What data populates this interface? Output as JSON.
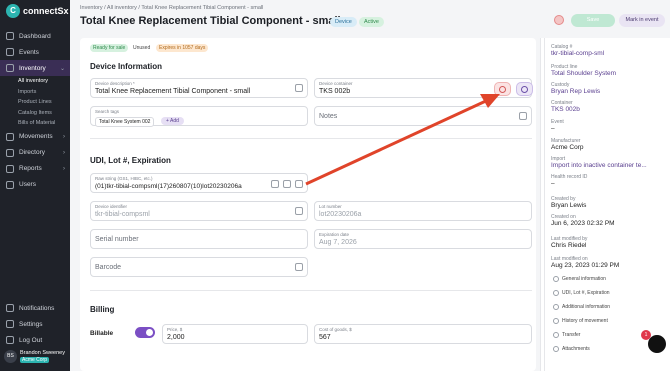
{
  "brand": {
    "name": "connectSx",
    "logo_letter": "C"
  },
  "nav": {
    "items": [
      {
        "label": "Dashboard"
      },
      {
        "label": "Events"
      },
      {
        "label": "Inventory"
      }
    ],
    "inventory_sub": [
      "All inventory",
      "Imports",
      "Product Lines",
      "Catalog Items",
      "Bills of Material"
    ],
    "items_after": [
      {
        "label": "Movements"
      },
      {
        "label": "Directory"
      },
      {
        "label": "Reports"
      },
      {
        "label": "Users"
      }
    ],
    "bottom": [
      {
        "label": "Notifications"
      },
      {
        "label": "Settings"
      },
      {
        "label": "Log Out"
      }
    ]
  },
  "user": {
    "initials": "BS",
    "name": "Brandon Sweeney",
    "org": "Acme Corp"
  },
  "breadcrumb": "Inventory / All inventory / Total Knee Replacement Tibial Component - small",
  "page_title": "Total Knee Replacement Tibial Component - small",
  "badges": {
    "device": "Device",
    "active": "Active"
  },
  "buttons": {
    "save": "Save",
    "mark": "Mark in event"
  },
  "status_pills": {
    "ready": "Ready for sale",
    "unused": "Unused",
    "expires": "Expires in 1057 days"
  },
  "device_info": {
    "section": "Device Information",
    "description_label": "Device description *",
    "description_value": "Total Knee Replacement Tibial Component - small",
    "container_label": "Device container",
    "container_value": "TKS 002b",
    "tags_label": "Search tags",
    "tag": "Total Knee System 002",
    "add_tag": "+ Add",
    "notes_placeholder": "Notes"
  },
  "udi": {
    "section": "UDI, Lot #, Expiration",
    "raw_label": "Raw string (GS1, HIBC, etc.)",
    "raw_value": "(01)tkr-tibial-compsml(17)260807(10)lot20230206a",
    "device_id_label": "Device identifier",
    "device_id_value": "tkr-tibial-compsml",
    "lot_label": "Lot number",
    "lot_value": "lot20230206a",
    "serial_placeholder": "Serial number",
    "exp_label": "Expiration date",
    "exp_value": "Aug 7, 2026",
    "barcode_placeholder": "Barcode"
  },
  "billing": {
    "section": "Billing",
    "billable_label": "Billable",
    "billable_on": true,
    "price_label": "Price, $",
    "price_value": "2,000",
    "cost_label": "Cost of goods, $",
    "cost_value": "567"
  },
  "details": {
    "rows": [
      {
        "label": "Catalog #",
        "value": "tkr-tibial-comp-sml",
        "link": true
      },
      {
        "label": "Product line",
        "value": "Total Shoulder System",
        "link": true
      },
      {
        "label": "Custody",
        "value": "Bryan Rep Lewis",
        "link": true
      },
      {
        "label": "Container",
        "value": "TKS 002b",
        "link": true
      },
      {
        "label": "Event",
        "value": "–",
        "link": false
      },
      {
        "label": "Manufacturer",
        "value": "Acme Corp",
        "link": false
      },
      {
        "label": "Import",
        "value": "Import into inactive container te...",
        "link": true
      },
      {
        "label": "Health record ID",
        "value": "–",
        "link": false
      },
      {
        "label": "Created by",
        "value": "Bryan Lewis",
        "link": false
      },
      {
        "label": "Created on",
        "value": "Jun 6, 2023 02:32 PM",
        "link": false
      },
      {
        "label": "Last modified by",
        "value": "Chris Riedel",
        "link": false
      },
      {
        "label": "Last modified on",
        "value": "Aug 23, 2023 01:29 PM",
        "link": false
      }
    ],
    "links": [
      "General information",
      "UDI, Lot #, Expiration",
      "Additional information",
      "History of movement",
      "Transfer",
      "Attachments"
    ]
  },
  "notification_count": "1",
  "colors": {
    "accent": "#7b4fc4",
    "teal": "#2cb4b0",
    "arrow": "#e0442a",
    "sidebar": "#1f2229"
  }
}
